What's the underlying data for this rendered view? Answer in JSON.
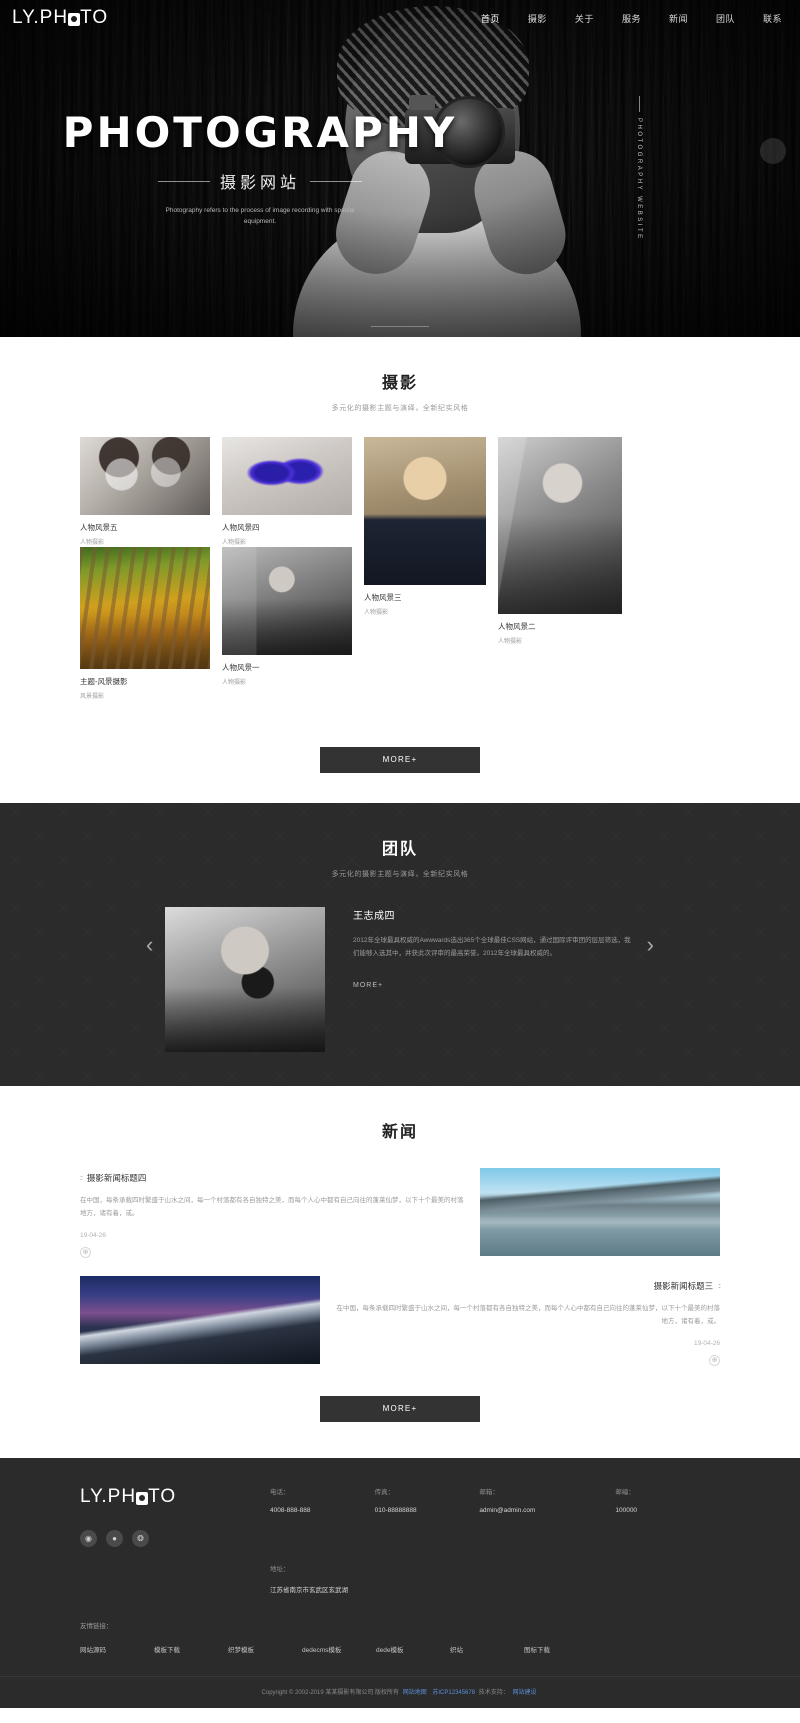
{
  "brand": {
    "name_pre": "LY.PH",
    "name_post": "TO",
    "icon": "camera-icon"
  },
  "nav": {
    "items": [
      {
        "label": "首页"
      },
      {
        "label": "摄影"
      },
      {
        "label": "关于"
      },
      {
        "label": "服务"
      },
      {
        "label": "新闻"
      },
      {
        "label": "团队"
      },
      {
        "label": "联系"
      }
    ]
  },
  "hero": {
    "title": "PHOTOGRAPHY",
    "subtitle": "摄影网站",
    "description": "Photography refers to the process of image recording with special equipment.",
    "vertical_text": "PHOTOGRAPHY WEBSITE"
  },
  "photography": {
    "title": "摄影",
    "subtitle": "多元化的摄影主题与演绎，全新纪实风格",
    "more_label": "MORE+",
    "items": [
      {
        "caption": "人物风景五",
        "category": "人物摄影"
      },
      {
        "caption": "人物风景四",
        "category": "人物摄影"
      },
      {
        "caption": "人物风景三",
        "category": "人物摄影"
      },
      {
        "caption": "人物风景二",
        "category": "人物摄影"
      },
      {
        "caption": "主题-风景摄影",
        "category": "风景摄影"
      },
      {
        "caption": "人物风景一",
        "category": "人物摄影"
      }
    ]
  },
  "team": {
    "title": "团队",
    "subtitle": "多元化的摄影主题与演绎，全新纪实风格",
    "member_name": "王志成四",
    "member_desc": "2012年全球最具权威的Awwwards选出365个全球最佳CSS网站，通过国际评审团的层层筛选，我们能够入选其中，并获此次评审的最高荣誉。2012年全球最具权威的。",
    "more_label": "MORE+",
    "prev_icon": "chevron-left-icon",
    "next_icon": "chevron-right-icon"
  },
  "news": {
    "title": "新闻",
    "more_label": "MORE+",
    "items": [
      {
        "title": "摄影新闻标题四",
        "marker": "::",
        "body": "在中国，每条承载四时繁盛于山水之间，每一个村落都有各自独特之美，而每个人心中都有自己向往的蓬莱仙梦，以下十个最美的村落地方，诸有着，或。",
        "date": "19-04-26",
        "plus": "⊕"
      },
      {
        "title": "摄影新闻标题三",
        "marker": "::",
        "body": "在中国，每条承载四时繁盛于山水之间，每一个村落都有各自独特之美，而每个人心中都有自己向往的蓬莱仙梦，以下十个最美的村落地方，诸有着，或。",
        "date": "19-04-26",
        "plus": "⊕"
      }
    ]
  },
  "footer": {
    "contact": [
      {
        "label": "电话：",
        "value": "4008-888-888"
      },
      {
        "label": "传真：",
        "value": "010-88888888"
      },
      {
        "label": "邮箱：",
        "value": "admin@admin.com"
      },
      {
        "label": "邮编：",
        "value": "100000"
      }
    ],
    "address_label": "地址：",
    "address_value": "江苏省南京市玄武区玄武湖",
    "links_title": "友情链接：",
    "links": [
      {
        "label": "网站源码"
      },
      {
        "label": "模板下载"
      },
      {
        "label": "织梦模板"
      },
      {
        "label": "dedecms模板"
      },
      {
        "label": "dede模板"
      },
      {
        "label": "织站"
      },
      {
        "label": "图标下载"
      }
    ],
    "social": [
      {
        "icon": "weibo-icon",
        "glyph": "◉"
      },
      {
        "icon": "wechat-icon",
        "glyph": "●"
      },
      {
        "icon": "qq-icon",
        "glyph": "❂"
      }
    ],
    "copyright_text": "Copyright © 2002-2019 某某摄影有限公司 版权所有",
    "copyright_link1": "网站地图",
    "copyright_icp": "苏ICP12345678",
    "copyright_mid": "技术支持：",
    "copyright_link2": "网站建设"
  },
  "colors": {
    "dark": "#2b2b2b",
    "button": "#333333",
    "accent": "#5b8fd6"
  }
}
